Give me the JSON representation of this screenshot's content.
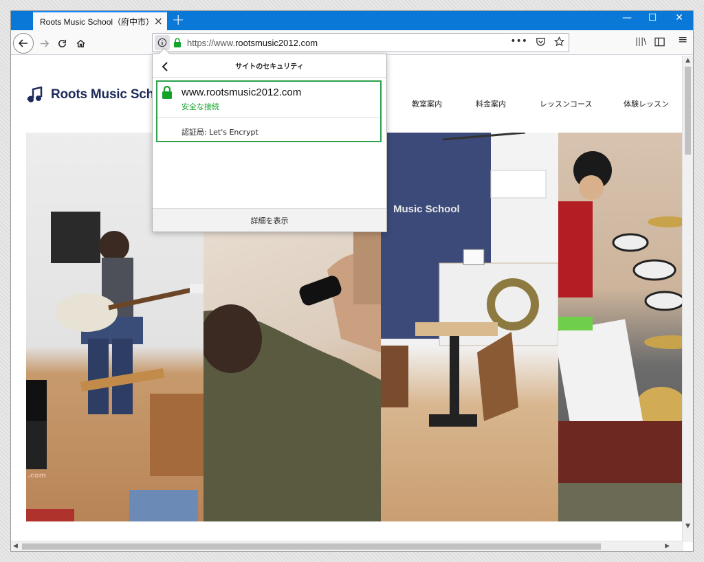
{
  "browser": {
    "tab_title": "Roots Music School（府中市）ギター",
    "tab_close": "×",
    "new_tab": "+",
    "window_controls": {
      "minimize": "—",
      "maximize": "☐",
      "close": "✕"
    },
    "url_prefix": "https://www.",
    "url_domain": "rootsmusic2012.com",
    "url_more": "•••",
    "library_icon": "|||\\",
    "menu_icon": "≡"
  },
  "site": {
    "logo_text": "Roots Music School",
    "nav": [
      "教室案内",
      "料金案内",
      "レッスンコース",
      "体験レッスン"
    ],
    "photo_sign": "Music School",
    "photo_domain_fragment": ".com"
  },
  "security_popup": {
    "title": "サイトのセキュリティ",
    "host": "www.rootsmusic2012.com",
    "status": "安全な接続",
    "issuer": "認証局: Let's Encrypt",
    "more_info": "詳細を表示"
  },
  "colors": {
    "tabbar": "#0a78d7",
    "secure_green": "#12a329",
    "highlight_border": "#2aa14a",
    "logo_navy": "#1e2a5a"
  }
}
